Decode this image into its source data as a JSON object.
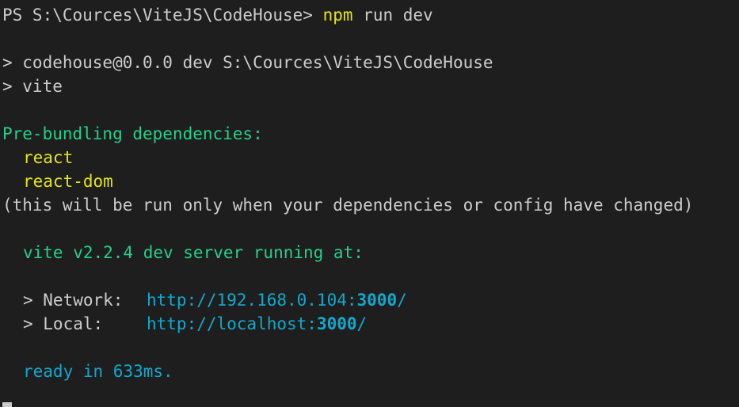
{
  "prompt": {
    "ps_path": "PS S:\\Cources\\ViteJS\\CodeHouse>",
    "command_npm": "npm",
    "command_args": "run dev"
  },
  "script_header": {
    "line1": "> codehouse@0.0.0 dev S:\\Cources\\ViteJS\\CodeHouse",
    "line2": "> vite"
  },
  "prebundle": {
    "heading": "Pre-bundling dependencies:",
    "deps": [
      "react",
      "react-dom"
    ],
    "note": "(this will be run only when your dependencies or config have changed)"
  },
  "server": {
    "running": "vite v2.2.4 dev server running at:",
    "network_label": "> Network:",
    "network_url_prefix": "http://192.168.0.104:",
    "network_port": "3000",
    "network_url_suffix": "/",
    "local_label": "> Local:",
    "local_url_prefix": "http://localhost:",
    "local_port": "3000",
    "local_url_suffix": "/",
    "ready": "ready in 633ms."
  },
  "colors": {
    "background": "#1e1e1e",
    "text": "#cccccc",
    "yellow": "#e5e510",
    "green": "#23d18b",
    "cyan": "#11a8cd"
  }
}
